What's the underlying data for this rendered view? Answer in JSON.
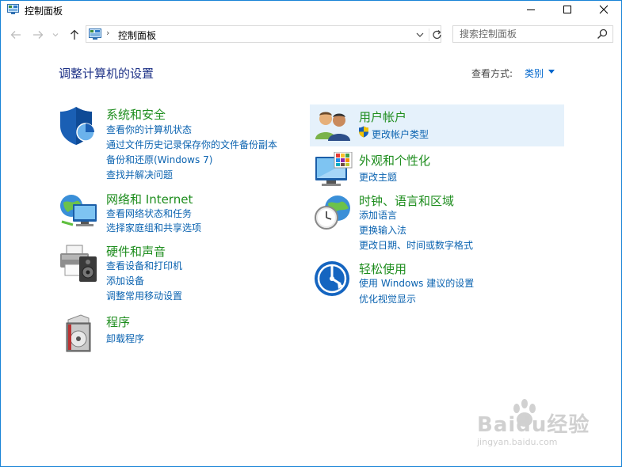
{
  "window": {
    "title": "控制面板"
  },
  "address": {
    "path": "控制面板",
    "separator": "›"
  },
  "search": {
    "placeholder": "搜索控制面板"
  },
  "page": {
    "heading": "调整计算机的设置",
    "view_label": "查看方式:",
    "view_value": "类别"
  },
  "categories_left": [
    {
      "title": "系统和安全",
      "icon": "shield-icon",
      "links": [
        "查看你的计算机状态",
        "通过文件历史记录保存你的文件备份副本",
        "备份和还原(Windows 7)",
        "查找并解决问题"
      ]
    },
    {
      "title": "网络和 Internet",
      "icon": "network-globe-icon",
      "links": [
        "查看网络状态和任务",
        "选择家庭组和共享选项"
      ]
    },
    {
      "title": "硬件和声音",
      "icon": "printer-speaker-icon",
      "links": [
        "查看设备和打印机",
        "添加设备",
        "调整常用移动设置"
      ]
    },
    {
      "title": "程序",
      "icon": "programs-disc-icon",
      "links": [
        "卸载程序"
      ]
    }
  ],
  "categories_right": [
    {
      "title": "用户帐户",
      "icon": "user-accounts-icon",
      "links": [
        "更改帐户类型"
      ],
      "highlighted": true
    },
    {
      "title": "外观和个性化",
      "icon": "monitor-palette-icon",
      "links": [
        "更改主题"
      ]
    },
    {
      "title": "时钟、语言和区域",
      "icon": "clock-globe-icon",
      "links": [
        "添加语言",
        "更换输入法",
        "更改日期、时间或数字格式"
      ]
    },
    {
      "title": "轻松使用",
      "icon": "ease-of-access-icon",
      "links": [
        "使用 Windows 建议的设置",
        "优化视觉显示"
      ]
    }
  ],
  "watermark": {
    "brand": "Baidu经验",
    "url": "jingyan.baidu.com"
  },
  "colors": {
    "title_green": "#1e8d1e",
    "link_blue": "#0b63b0",
    "heading_blue": "#1e3287",
    "highlight": "#e5f1fb"
  }
}
